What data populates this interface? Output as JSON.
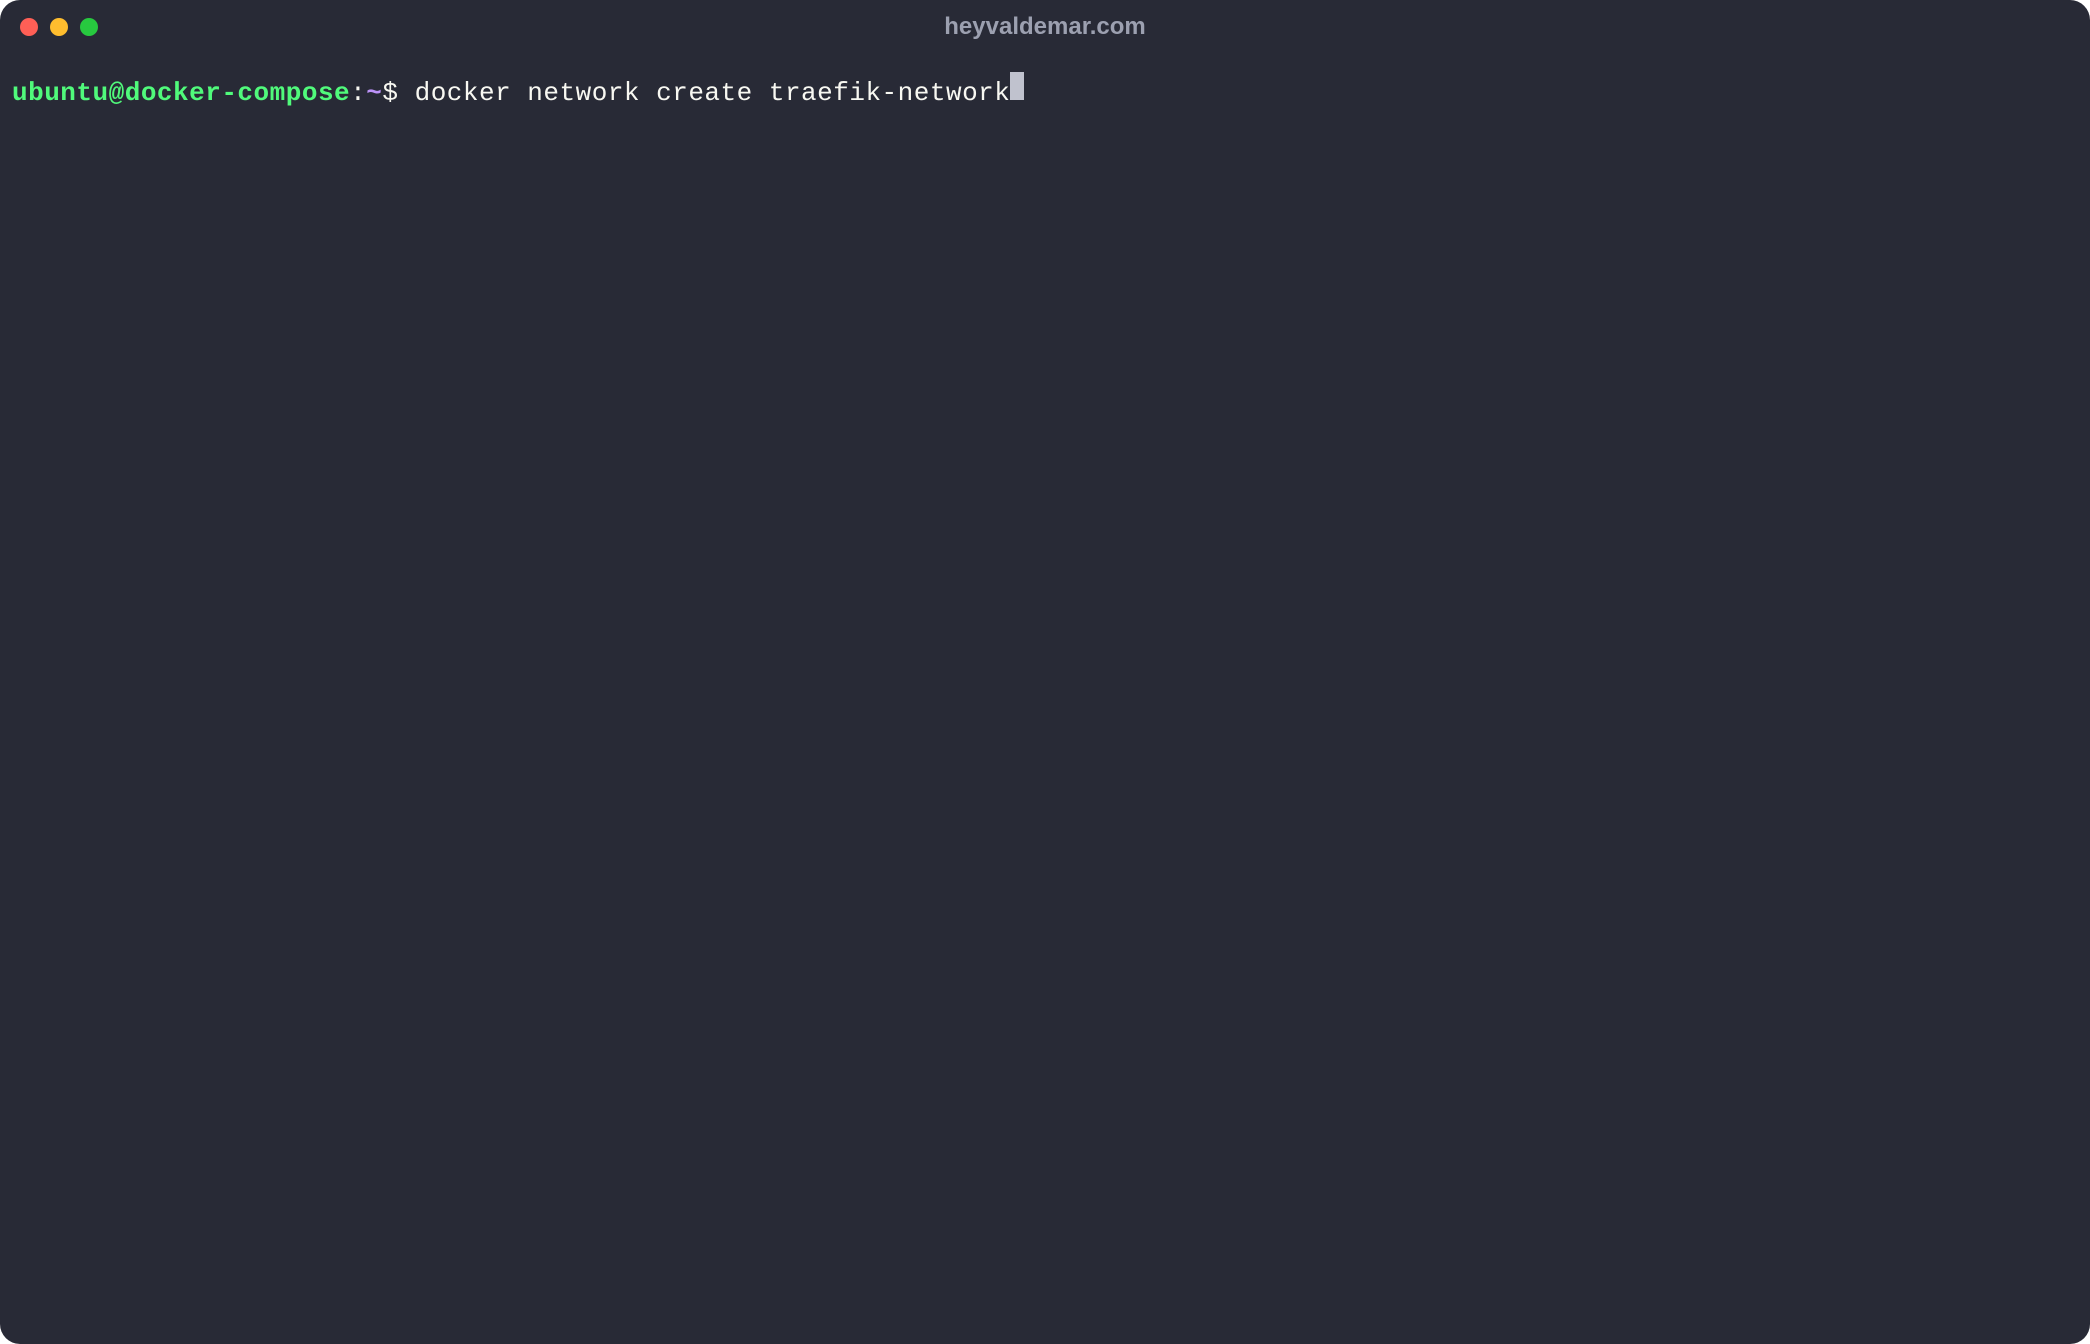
{
  "window": {
    "title": "heyvaldemar.com"
  },
  "prompt": {
    "user_host": "ubuntu@docker-compose",
    "colon": ":",
    "path": "~",
    "symbol": "$"
  },
  "command": {
    "text": " docker network create traefik-network"
  },
  "colors": {
    "background": "#282a36",
    "prompt_green": "#50fa7b",
    "prompt_purple": "#bd93f9",
    "text": "#f8f8f2",
    "title": "#9ca0b0",
    "close": "#ff5f56",
    "minimize": "#ffbd2e",
    "maximize": "#27c93f"
  }
}
